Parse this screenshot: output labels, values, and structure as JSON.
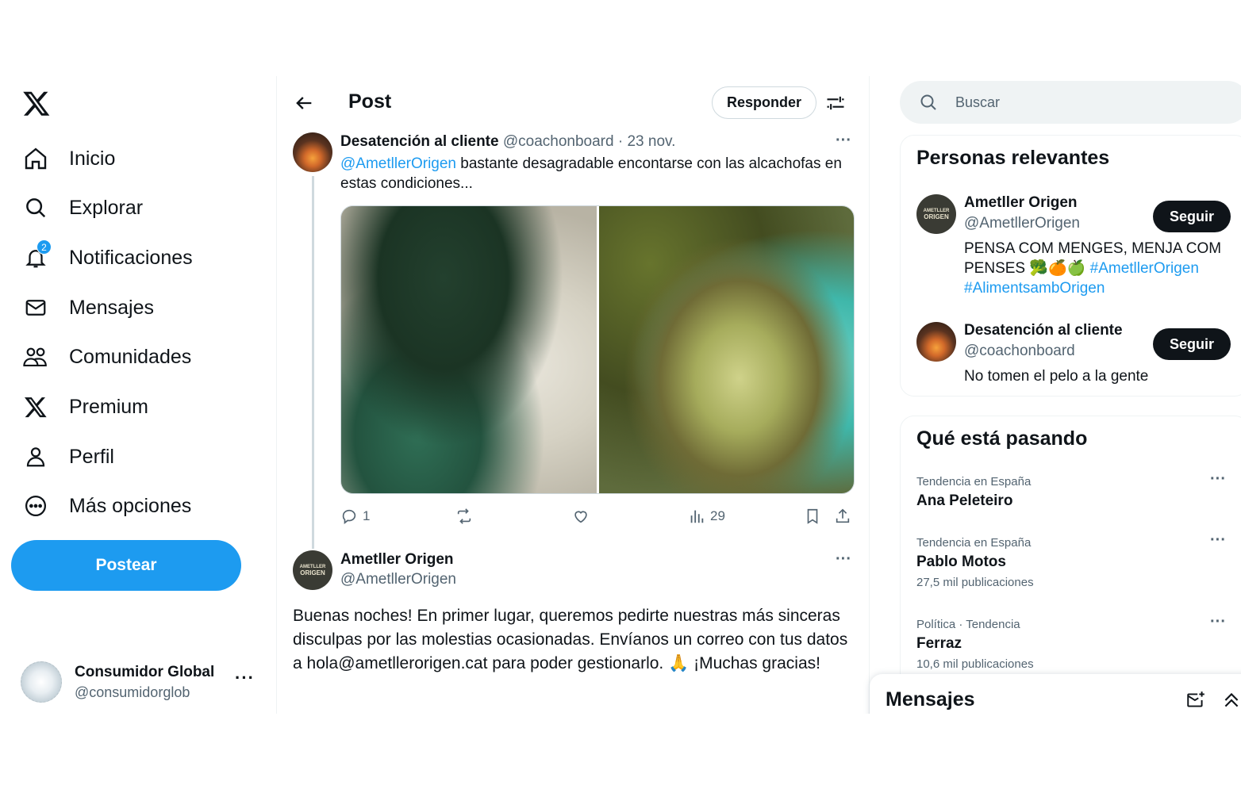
{
  "nav": {
    "items": [
      {
        "label": "Inicio",
        "icon": "home-icon"
      },
      {
        "label": "Explorar",
        "icon": "search-icon"
      },
      {
        "label": "Notificaciones",
        "icon": "bell-icon",
        "badge": "2"
      },
      {
        "label": "Mensajes",
        "icon": "mail-icon"
      },
      {
        "label": "Comunidades",
        "icon": "people-icon"
      },
      {
        "label": "Premium",
        "icon": "x-logo-icon"
      },
      {
        "label": "Perfil",
        "icon": "person-icon"
      },
      {
        "label": "Más opciones",
        "icon": "more-circle-icon"
      }
    ],
    "post_label": "Postear",
    "account": {
      "name": "Consumidor Global",
      "handle": "@consumidorglob"
    }
  },
  "header": {
    "title": "Post",
    "reply_label": "Responder"
  },
  "tweet": {
    "author": "Desatención al cliente",
    "handle": "@coachonboard",
    "sep": " · ",
    "date": "23 nov.",
    "mention": "@AmetllerOrigen",
    "text": " bastante desagradable encontarse con las alcachofas en estas condiciones...",
    "replies": "1",
    "views": "29"
  },
  "reply": {
    "author": "Ametller Origen",
    "handle": "@AmetllerOrigen",
    "text": "Buenas noches! En primer lugar, queremos pedirte nuestras más sinceras disculpas por las molestias ocasionadas. Envíanos un correo con tus datos a hola@ametllerorigen.cat para poder gestionarlo. 🙏 ¡Muchas gracias!"
  },
  "search": {
    "placeholder": "Buscar"
  },
  "people": {
    "title": "Personas relevantes",
    "follow_label": "Seguir",
    "list": [
      {
        "name": "Ametller Origen",
        "handle": "@AmetllerOrigen",
        "bio": "PENSA COM MENGES, MENJA COM PENSES 🥦🍊🍏 ",
        "tags": "#AmetllerOrigen #AlimentsambOrigen"
      },
      {
        "name": "Desatención al cliente",
        "handle": "@coachonboard",
        "bio": "No tomen el pelo a la gente"
      }
    ]
  },
  "trends": {
    "title": "Qué está pasando",
    "list": [
      {
        "context": "Tendencia en España",
        "name": "Ana Peleteiro",
        "count": ""
      },
      {
        "context": "Tendencia en España",
        "name": "Pablo Motos",
        "count": "27,5 mil publicaciones"
      },
      {
        "context": "Política · Tendencia",
        "name": "Ferraz",
        "count": "10,6 mil publicaciones"
      }
    ]
  },
  "messages_dock": {
    "title": "Mensajes"
  },
  "avatar_text": {
    "ao_line1": "AMETLLER",
    "ao_line2": "ORIGEN"
  },
  "colors": {
    "accent": "#1d9bf0",
    "text": "#0f1419",
    "muted": "#536471",
    "border": "#eff3f4"
  }
}
